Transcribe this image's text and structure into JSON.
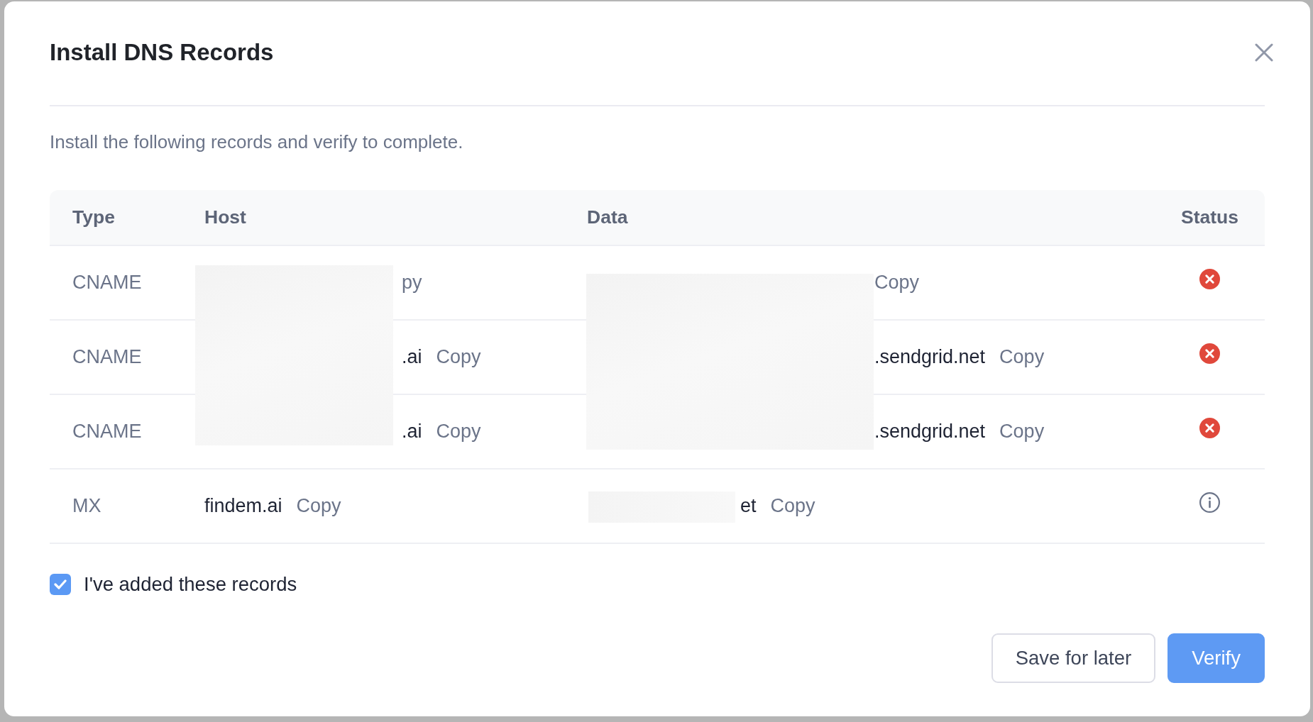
{
  "dialog": {
    "title": "Install DNS Records",
    "instructions": "Install the following records and verify to complete.",
    "table": {
      "columns": [
        "Type",
        "Host",
        "Data",
        "Status"
      ],
      "rows": [
        {
          "type": "CNAME",
          "host": {
            "kind": "covered",
            "copy": "py"
          },
          "data": {
            "kind": "covered",
            "copy": "Copy"
          },
          "status": {
            "kind": "error"
          }
        },
        {
          "type": "CNAME",
          "host": {
            "kind": "covered",
            "value": ".ai",
            "copy": "Copy"
          },
          "data": {
            "kind": "covered",
            "value": ".sendgrid.net",
            "copy": "Copy"
          },
          "status": {
            "kind": "error"
          }
        },
        {
          "type": "CNAME",
          "host": {
            "kind": "covered",
            "value": ".ai",
            "copy": "Copy"
          },
          "data": {
            "kind": "covered",
            "value": ".sendgrid.net",
            "copy": "Copy"
          },
          "status": {
            "kind": "error"
          }
        },
        {
          "type": "MX",
          "host": {
            "kind": "plain",
            "value": "findem.ai",
            "copy": "Copy"
          },
          "data": {
            "kind": "masked",
            "value": "et",
            "copy": "Copy"
          },
          "status": {
            "kind": "info"
          }
        }
      ]
    },
    "confirmation": {
      "label": "I've added these records",
      "checked": true
    },
    "buttons": [
      {
        "label": "Save for later",
        "kind": "secondary"
      },
      {
        "label": "Verify",
        "kind": "primary"
      }
    ]
  }
}
